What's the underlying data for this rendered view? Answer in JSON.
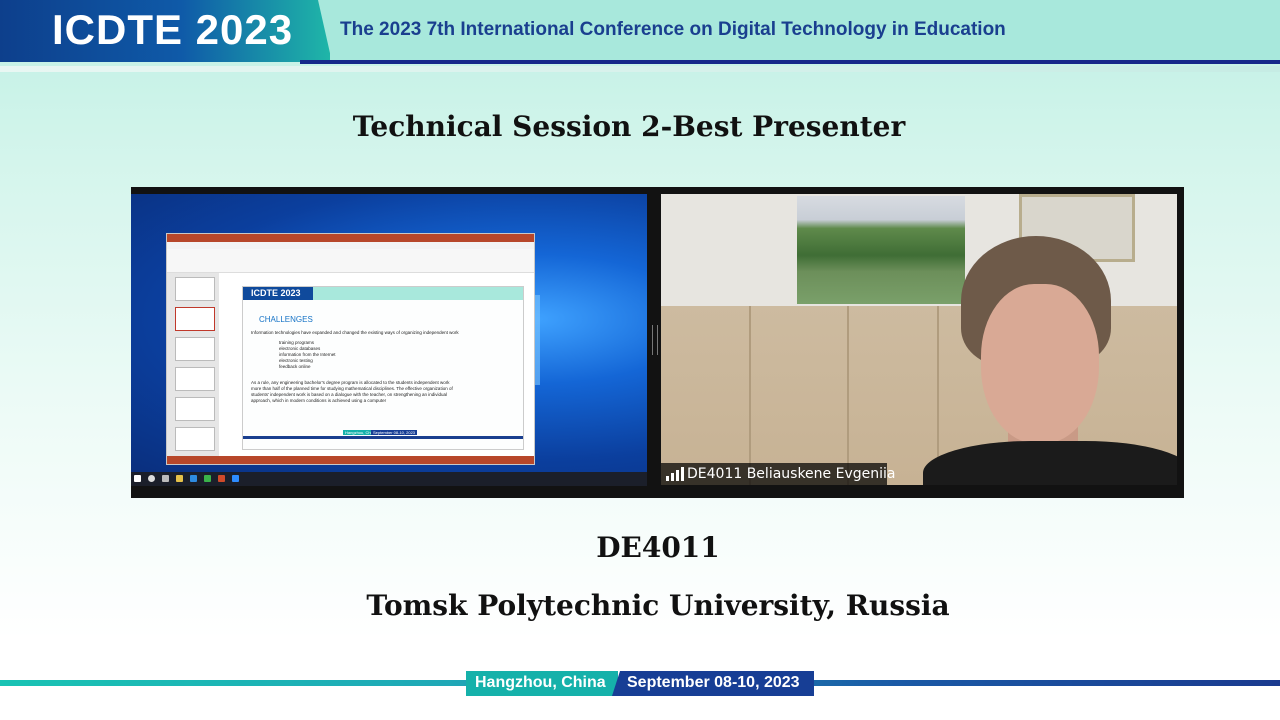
{
  "banner": {
    "logo_text": "ICDTE 2023",
    "title": "The 2023 7th International Conference on Digital Technology in Education"
  },
  "session_title": "Technical Session 2-Best Presenter",
  "shared_screen": {
    "slide": {
      "logo_text": "ICDTE 2023",
      "heading": "CHALLENGES",
      "intro": "Information technologies have expanded and changed the existing ways of organizing independent work",
      "bullets": [
        "training programs",
        "electronic databases",
        "information from the Internet",
        "electronic testing",
        "feedback online"
      ],
      "paragraph": [
        "As a rule, any engineering bachelor's degree program is allocated to the students independent work",
        "more than half of the planned time for studying mathematical disciplines. The effective organization of",
        "students' independent work is based on a dialogue with the teacher, on strengthening an individual",
        "approach, which in modern conditions is achieved using a computer"
      ],
      "footer_city": "Hangzhou, China",
      "footer_date": "September 08-10, 2023"
    }
  },
  "participant": {
    "name": "DE4011  Beliauskene Evgeniia"
  },
  "presenter_code": "DE4011",
  "university": "Tomsk Polytechnic University, Russia",
  "footer": {
    "city": "Hangzhou, China",
    "date": "September 08-10, 2023"
  },
  "colors": {
    "banner_blue": "#0f4a9c",
    "banner_teal": "#a8e8dc",
    "footer_teal": "#15b1aa",
    "footer_navy": "#173e95"
  }
}
